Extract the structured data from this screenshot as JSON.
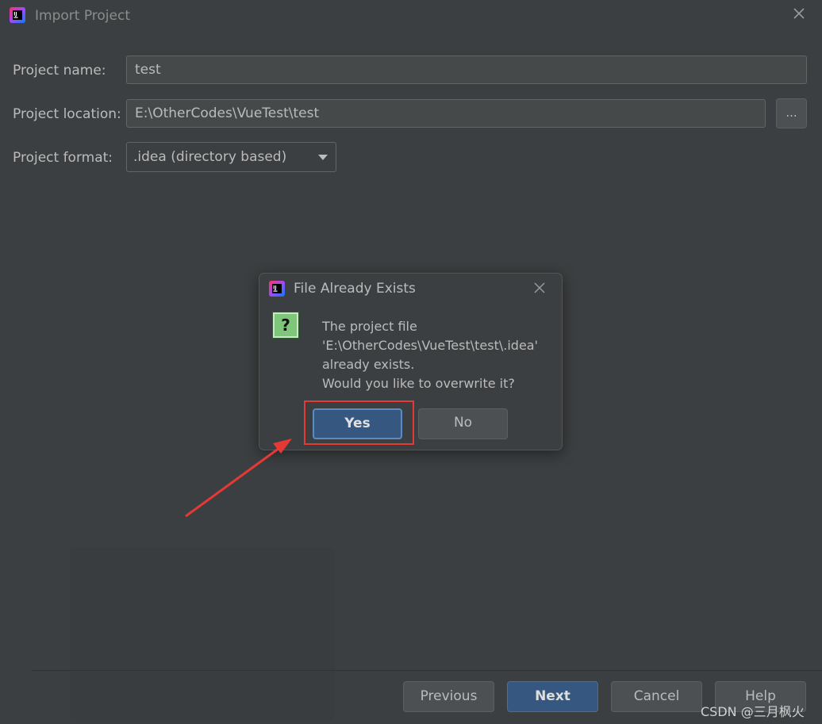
{
  "window": {
    "title": "Import Project",
    "icon": "intellij-icon"
  },
  "form": {
    "project_name_label": "Project name:",
    "project_name_value": "test",
    "project_location_label": "Project location:",
    "project_location_value": "E:\\OtherCodes\\VueTest\\test",
    "browse_label": "...",
    "project_format_label": "Project format:",
    "project_format_value": ".idea (directory based)"
  },
  "footer": {
    "previous_label": "Previous",
    "next_label": "Next",
    "cancel_label": "Cancel",
    "help_label": "Help"
  },
  "dialog": {
    "title": "File Already Exists",
    "icon": "question-icon",
    "question_glyph": "?",
    "message_lines": [
      "The project file",
      "'E:\\OtherCodes\\VueTest\\test\\.idea'",
      "already exists.",
      "Would you like to overwrite it?"
    ],
    "yes_label": "Yes",
    "no_label": "No"
  },
  "watermark": "CSDN @三月枫火",
  "colors": {
    "background": "#3c3f41",
    "primary_button": "#365880",
    "annotation_red": "#e53935"
  }
}
